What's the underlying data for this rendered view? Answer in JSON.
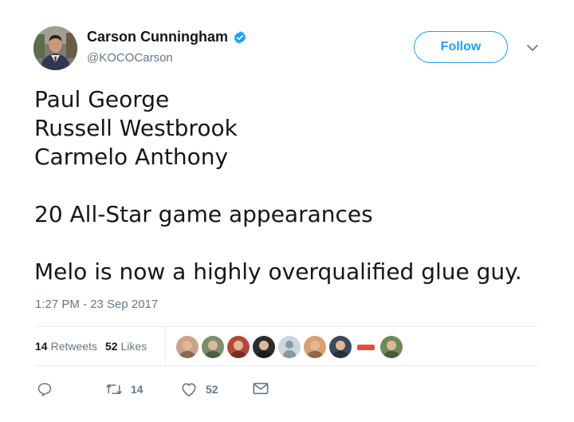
{
  "author": {
    "name": "Carson Cunningham",
    "handle": "@KOCOCarson",
    "verified": true,
    "avatar_icon": "profile-photo-man-in-suit"
  },
  "follow_button": {
    "label": "Follow"
  },
  "menu_icon": "chevron-down-icon",
  "tweet": {
    "lines": [
      "Paul George",
      "Russell Westbrook",
      "Carmelo Anthony"
    ],
    "line2": "20 All-Star game appearances",
    "line3": "Melo is now a highly overqualified glue guy."
  },
  "timestamp": "1:27 PM - 23 Sep 2017",
  "stats": {
    "retweets_count": "14",
    "retweets_label": "Retweets",
    "likes_count": "52",
    "likes_label": "Likes"
  },
  "likers": [
    {
      "icon": "liker-avatar-1",
      "color": "#c9a38a"
    },
    {
      "icon": "liker-avatar-2",
      "color": "#7c8f6a"
    },
    {
      "icon": "liker-avatar-3",
      "color": "#b5473a"
    },
    {
      "icon": "liker-avatar-4",
      "color": "#2c2c2c"
    },
    {
      "icon": "default-avatar-egg",
      "color": "#ccd6dd"
    },
    {
      "icon": "liker-avatar-6",
      "color": "#d9a070"
    },
    {
      "icon": "liker-avatar-7",
      "color": "#3a4a5c"
    },
    {
      "icon": "liker-avatar-8-car",
      "color": "#c0392b"
    },
    {
      "icon": "liker-avatar-9",
      "color": "#6f8a55"
    }
  ],
  "actions": {
    "reply_icon": "reply-icon",
    "retweet_icon": "retweet-icon",
    "retweet_count": "14",
    "like_icon": "heart-icon",
    "like_count": "52",
    "message_icon": "envelope-icon"
  },
  "colors": {
    "brand_blue": "#1da1f2",
    "text": "#14171a",
    "secondary": "#657786",
    "border": "#e6ecf0"
  }
}
